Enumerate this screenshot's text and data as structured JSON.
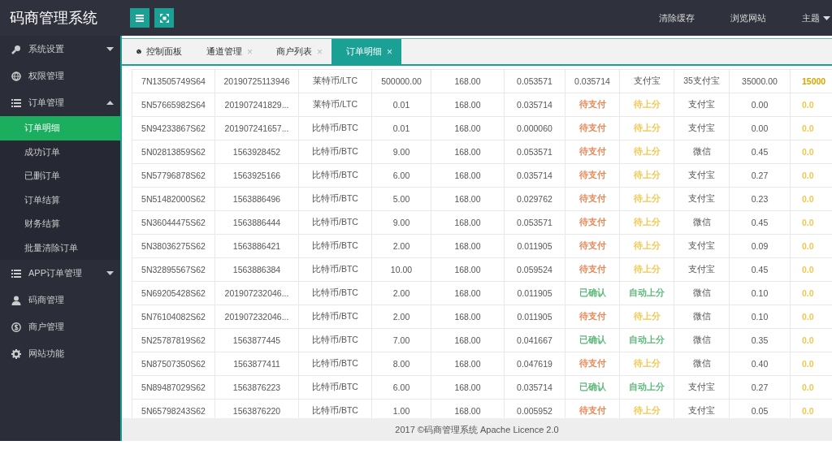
{
  "app_title": "码商管理系统",
  "top_links": [
    "清除缓存",
    "浏览网站"
  ],
  "theme_menu": {
    "label": "主题"
  },
  "sidebar": {
    "items": [
      {
        "label": "系统设置",
        "expanded": false
      },
      {
        "label": "权限管理"
      },
      {
        "label": "订单管理",
        "expanded": true,
        "children": [
          {
            "label": "订单明细",
            "selected": true
          },
          {
            "label": "成功订单",
            "selected": false
          },
          {
            "label": "已删订单",
            "selected": false
          },
          {
            "label": "订单结算",
            "selected": false
          },
          {
            "label": "财务结算",
            "selected": false
          },
          {
            "label": "批量清除订单",
            "selected": false
          }
        ]
      },
      {
        "label": "APP订单管理",
        "expanded": false
      },
      {
        "label": "码商管理"
      },
      {
        "label": "商户管理"
      },
      {
        "label": "网站功能"
      }
    ]
  },
  "tabs": [
    {
      "label": "控制面板",
      "selected": false,
      "closable": false
    },
    {
      "label": "通道管理",
      "selected": false,
      "closable": true
    },
    {
      "label": "商户列表",
      "selected": false,
      "closable": true
    },
    {
      "label": "订单明细",
      "selected": true,
      "closable": true
    }
  ],
  "close_glyph": "×",
  "table": {
    "rows": [
      {
        "cells": [
          "7N13505749S64",
          "20190725113946",
          "莱特币/LTC",
          "500000.00",
          "168.00",
          "0.053571",
          "0.035714",
          "支付宝",
          "35支付宝",
          "35000.00",
          {
            "text": "15000",
            "color": "#d9a300"
          }
        ]
      },
      {
        "cells": [
          "5N57665982S64",
          "201907241829...",
          "莱特币/LTC",
          "0.01",
          "168.00",
          "0.035714",
          {
            "text": "待支付",
            "color": "#e8895a"
          },
          {
            "text": "待上分",
            "color": "#f0c850"
          },
          "支付宝",
          "0.00",
          {
            "text": "0.0",
            "color": "#f0c850"
          }
        ]
      },
      {
        "cells": [
          "5N94233867S62",
          "201907241657...",
          "比特币/BTC",
          "0.01",
          "168.00",
          "0.000060",
          {
            "text": "待支付",
            "color": "#e8895a"
          },
          {
            "text": "待上分",
            "color": "#f0c850"
          },
          "支付宝",
          "0.00",
          {
            "text": "0.0",
            "color": "#f0c850"
          }
        ]
      },
      {
        "cells": [
          "5N02813859S62",
          "1563928452",
          "比特币/BTC",
          "9.00",
          "168.00",
          "0.053571",
          {
            "text": "待支付",
            "color": "#e8895a"
          },
          {
            "text": "待上分",
            "color": "#f0c850"
          },
          "微信",
          "0.45",
          {
            "text": "0.0",
            "color": "#f0c850"
          }
        ]
      },
      {
        "cells": [
          "5N57796878S62",
          "1563925166",
          "比特币/BTC",
          "6.00",
          "168.00",
          "0.035714",
          {
            "text": "待支付",
            "color": "#e8895a"
          },
          {
            "text": "待上分",
            "color": "#f0c850"
          },
          "支付宝",
          "0.27",
          {
            "text": "0.0",
            "color": "#f0c850"
          }
        ]
      },
      {
        "cells": [
          "5N51482000S62",
          "1563886496",
          "比特币/BTC",
          "5.00",
          "168.00",
          "0.029762",
          {
            "text": "待支付",
            "color": "#e8895a"
          },
          {
            "text": "待上分",
            "color": "#f0c850"
          },
          "支付宝",
          "0.23",
          {
            "text": "0.0",
            "color": "#f0c850"
          }
        ]
      },
      {
        "cells": [
          "5N36044475S62",
          "1563886444",
          "比特币/BTC",
          "9.00",
          "168.00",
          "0.053571",
          {
            "text": "待支付",
            "color": "#e8895a"
          },
          {
            "text": "待上分",
            "color": "#f0c850"
          },
          "微信",
          "0.45",
          {
            "text": "0.0",
            "color": "#f0c850"
          }
        ]
      },
      {
        "cells": [
          "5N38036275S62",
          "1563886421",
          "比特币/BTC",
          "2.00",
          "168.00",
          "0.011905",
          {
            "text": "待支付",
            "color": "#e8895a"
          },
          {
            "text": "待上分",
            "color": "#f0c850"
          },
          "支付宝",
          "0.09",
          {
            "text": "0.0",
            "color": "#f0c850"
          }
        ]
      },
      {
        "cells": [
          "5N32895567S62",
          "1563886384",
          "比特币/BTC",
          "10.00",
          "168.00",
          "0.059524",
          {
            "text": "待支付",
            "color": "#e8895a"
          },
          {
            "text": "待上分",
            "color": "#f0c850"
          },
          "支付宝",
          "0.45",
          {
            "text": "0.0",
            "color": "#f0c850"
          }
        ]
      },
      {
        "cells": [
          "5N69205428S62",
          "201907232046...",
          "比特币/BTC",
          "2.00",
          "168.00",
          "0.011905",
          {
            "text": "已确认",
            "color": "#5cb878"
          },
          {
            "text": "自动上分",
            "color": "#5cb878"
          },
          "微信",
          "0.10",
          {
            "text": "0.0",
            "color": "#f0c850"
          }
        ]
      },
      {
        "cells": [
          "5N76104082S62",
          "201907232046...",
          "比特币/BTC",
          "2.00",
          "168.00",
          "0.011905",
          {
            "text": "待支付",
            "color": "#e8895a"
          },
          {
            "text": "待上分",
            "color": "#f0c850"
          },
          "微信",
          "0.10",
          {
            "text": "0.0",
            "color": "#f0c850"
          }
        ]
      },
      {
        "cells": [
          "5N25787819S62",
          "1563877445",
          "比特币/BTC",
          "7.00",
          "168.00",
          "0.041667",
          {
            "text": "已确认",
            "color": "#5cb878"
          },
          {
            "text": "自动上分",
            "color": "#5cb878"
          },
          "微信",
          "0.35",
          {
            "text": "0.0",
            "color": "#f0c850"
          }
        ]
      },
      {
        "cells": [
          "5N87507350S62",
          "1563877411",
          "比特币/BTC",
          "8.00",
          "168.00",
          "0.047619",
          {
            "text": "待支付",
            "color": "#e8895a"
          },
          {
            "text": "待上分",
            "color": "#f0c850"
          },
          "微信",
          "0.40",
          {
            "text": "0.0",
            "color": "#f0c850"
          }
        ]
      },
      {
        "cells": [
          "5N89487029S62",
          "1563876223",
          "比特币/BTC",
          "6.00",
          "168.00",
          "0.035714",
          {
            "text": "已确认",
            "color": "#5cb878"
          },
          {
            "text": "自动上分",
            "color": "#5cb878"
          },
          "支付宝",
          "0.27",
          {
            "text": "0.0",
            "color": "#f0c850"
          }
        ]
      },
      {
        "cells": [
          "5N65798243S62",
          "1563876220",
          "比特币/BTC",
          "1.00",
          "168.00",
          "0.005952",
          {
            "text": "待支付",
            "color": "#e8895a"
          },
          {
            "text": "待上分",
            "color": "#f0c850"
          },
          "支付宝",
          "0.05",
          {
            "text": "0.0",
            "color": "#f0c850"
          }
        ]
      }
    ]
  },
  "footer": "2017 ©码商管理系统 Apache Licence 2.0"
}
